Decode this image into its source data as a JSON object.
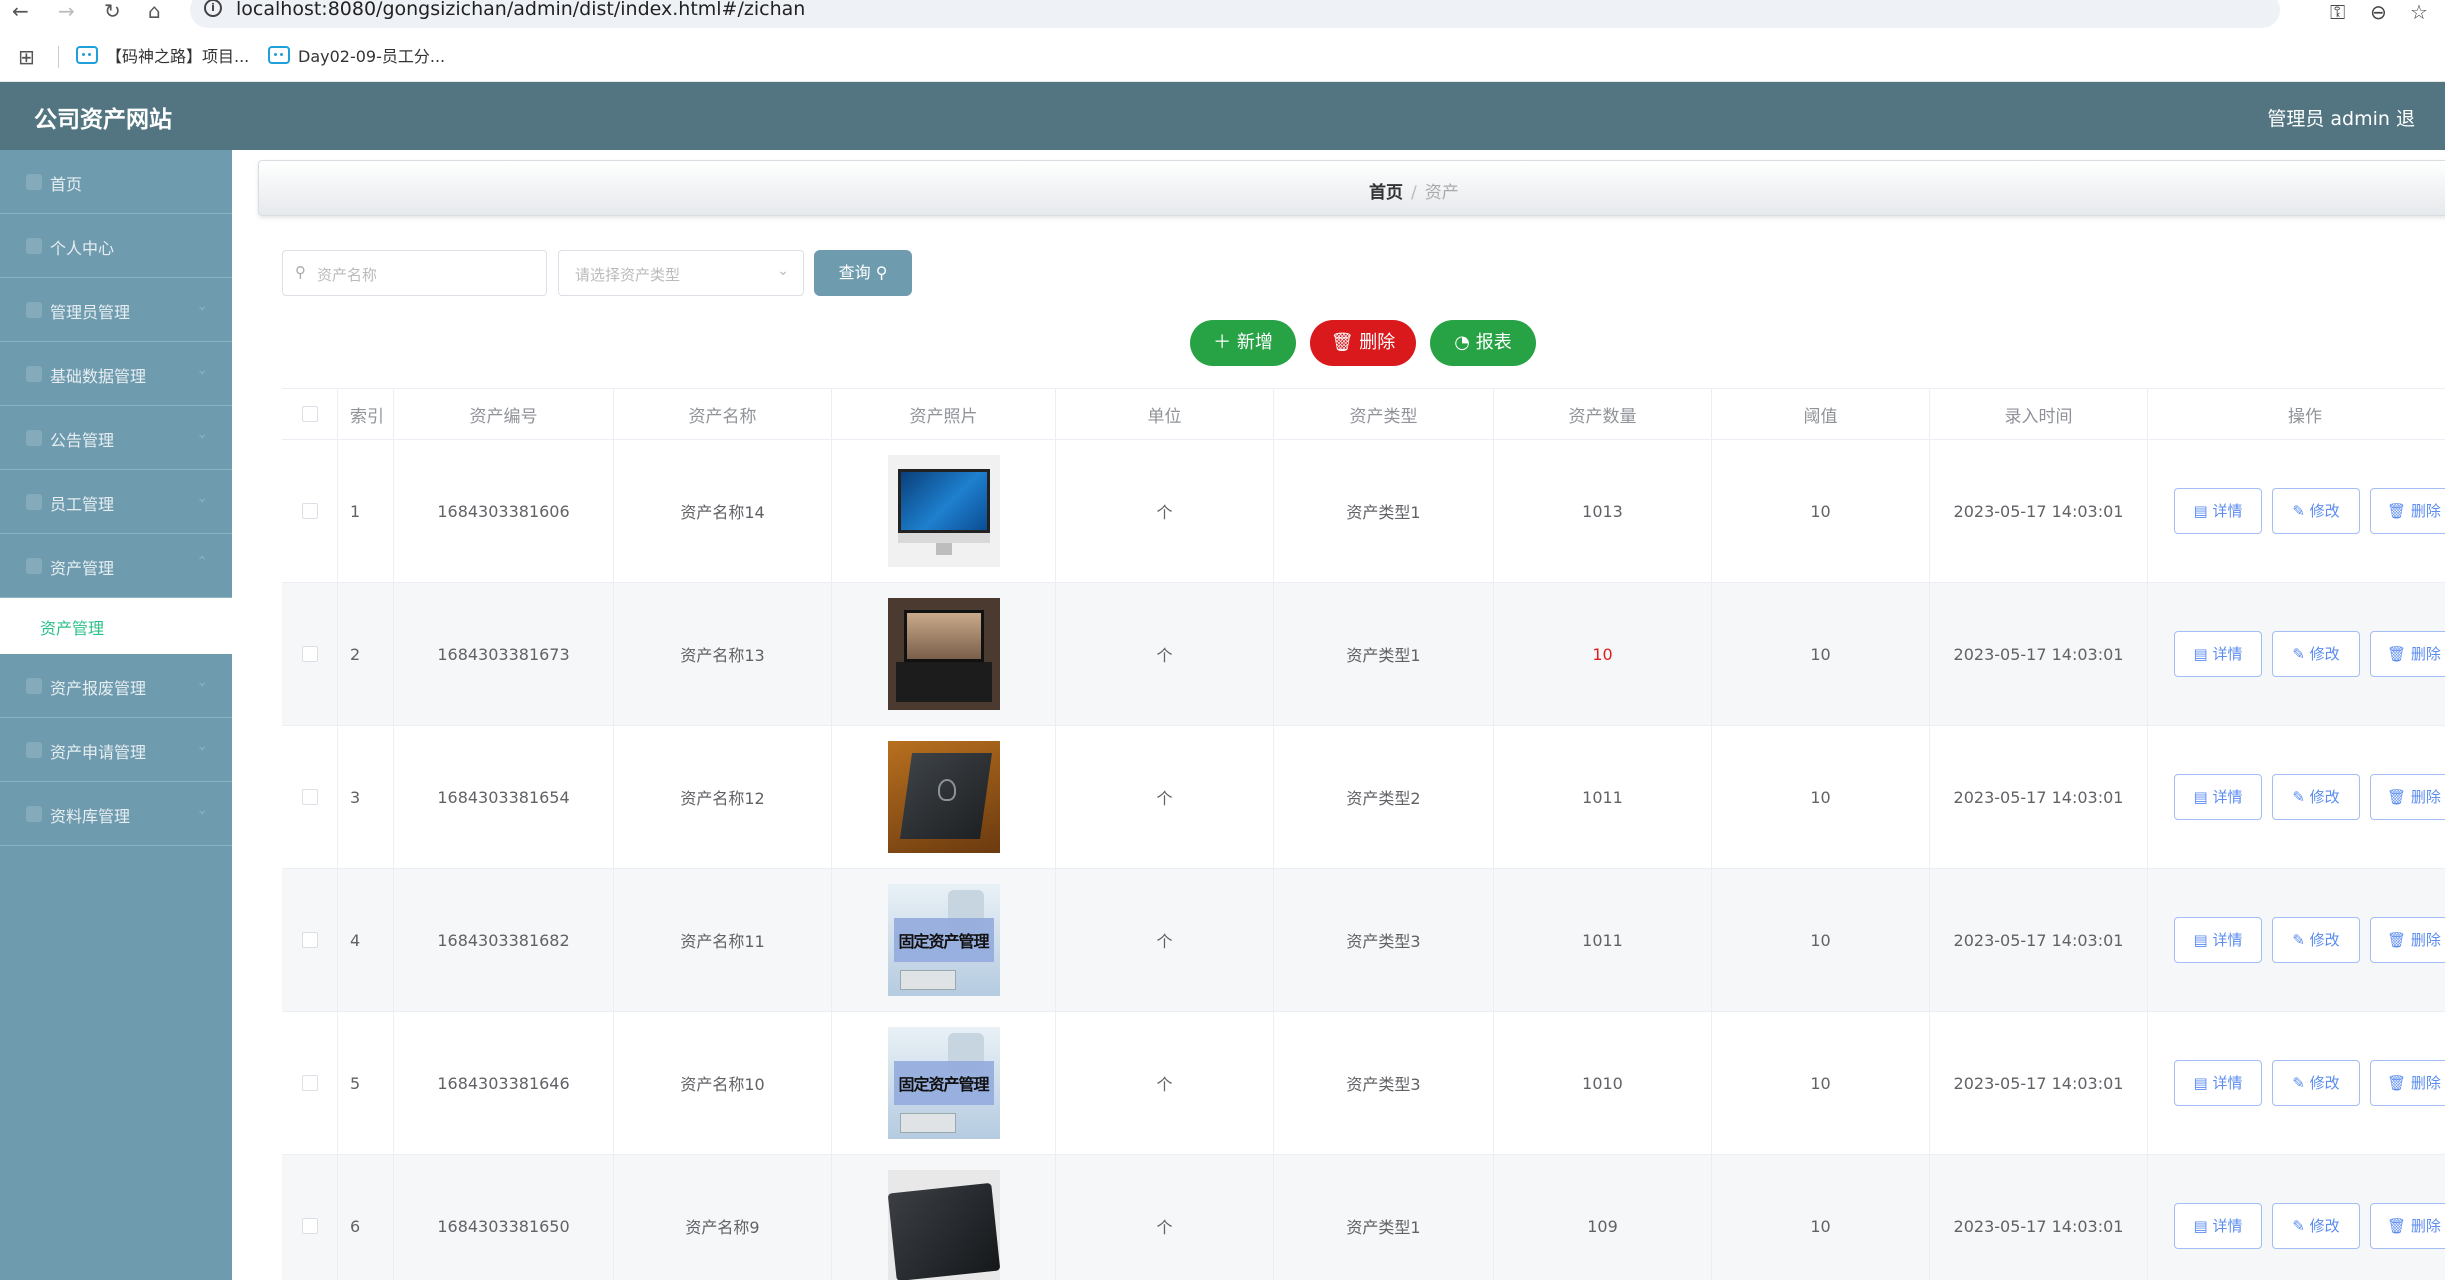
{
  "browser": {
    "url": "localhost:8080/gongsizichan/admin/dist/index.html#/zichan",
    "bookmarks": [
      {
        "label": "【码神之路】项目..."
      },
      {
        "label": "Day02-09-员工分..."
      }
    ]
  },
  "header": {
    "title": "公司资产网站",
    "user": "管理员 admin  退"
  },
  "sidebar": {
    "items": [
      {
        "label": "首页"
      },
      {
        "label": "个人中心"
      },
      {
        "label": "管理员管理"
      },
      {
        "label": "基础数据管理"
      },
      {
        "label": "公告管理"
      },
      {
        "label": "员工管理"
      },
      {
        "label": "资产管理"
      },
      {
        "label": "资产报废管理"
      },
      {
        "label": "资产申请管理"
      },
      {
        "label": "资料库管理"
      }
    ],
    "sub_active": "资产管理"
  },
  "breadcrumb": {
    "home": "首页",
    "sep": "/",
    "current": "资产"
  },
  "search": {
    "name_placeholder": "资产名称",
    "type_placeholder": "请选择资产类型",
    "query_label": "查询"
  },
  "actions": {
    "add": "新增",
    "delete": "删除",
    "report": "报表"
  },
  "table": {
    "headers": [
      "索引",
      "资产编号",
      "资产名称",
      "资产照片",
      "单位",
      "资产类型",
      "资产数量",
      "阈值",
      "录入时间",
      "操作"
    ],
    "op_labels": {
      "detail": "详情",
      "modify": "修改",
      "delete": "删除"
    },
    "rows": [
      {
        "index": "1",
        "no": "1684303381606",
        "name": "资产名称14",
        "photo": "imac",
        "unit": "个",
        "type": "资产类型1",
        "qty": "1013",
        "threshold": "10",
        "time": "2023-05-17 14:03:01"
      },
      {
        "index": "2",
        "no": "1684303381673",
        "name": "资产名称13",
        "photo": "laptop-open",
        "unit": "个",
        "type": "资产类型1",
        "qty": "10",
        "threshold": "10",
        "time": "2023-05-17 14:03:01"
      },
      {
        "index": "3",
        "no": "1684303381654",
        "name": "资产名称12",
        "photo": "laptop-closed",
        "unit": "个",
        "type": "资产类型2",
        "qty": "1011",
        "threshold": "10",
        "time": "2023-05-17 14:03:01"
      },
      {
        "index": "4",
        "no": "1684303381682",
        "name": "资产名称11",
        "photo": "asset-banner",
        "photo_text": "固定资产管理",
        "unit": "个",
        "type": "资产类型3",
        "qty": "1011",
        "threshold": "10",
        "time": "2023-05-17 14:03:01"
      },
      {
        "index": "5",
        "no": "1684303381646",
        "name": "资产名称10",
        "photo": "asset-banner",
        "photo_text": "固定资产管理",
        "unit": "个",
        "type": "资产类型3",
        "qty": "1010",
        "threshold": "10",
        "time": "2023-05-17 14:03:01"
      },
      {
        "index": "6",
        "no": "1684303381650",
        "name": "资产名称9",
        "photo": "laptop-dark",
        "unit": "个",
        "type": "资产类型1",
        "qty": "109",
        "threshold": "10",
        "time": "2023-05-17 14:03:01"
      }
    ]
  },
  "colors": {
    "header_bg": "#527581",
    "sidebar_bg": "#6f9bae",
    "active_text": "#2cc089",
    "add_green": "#27a345",
    "delete_red": "#d9191c",
    "qty_warning": "#e11d1d",
    "op_blue": "#5b8cf0"
  }
}
